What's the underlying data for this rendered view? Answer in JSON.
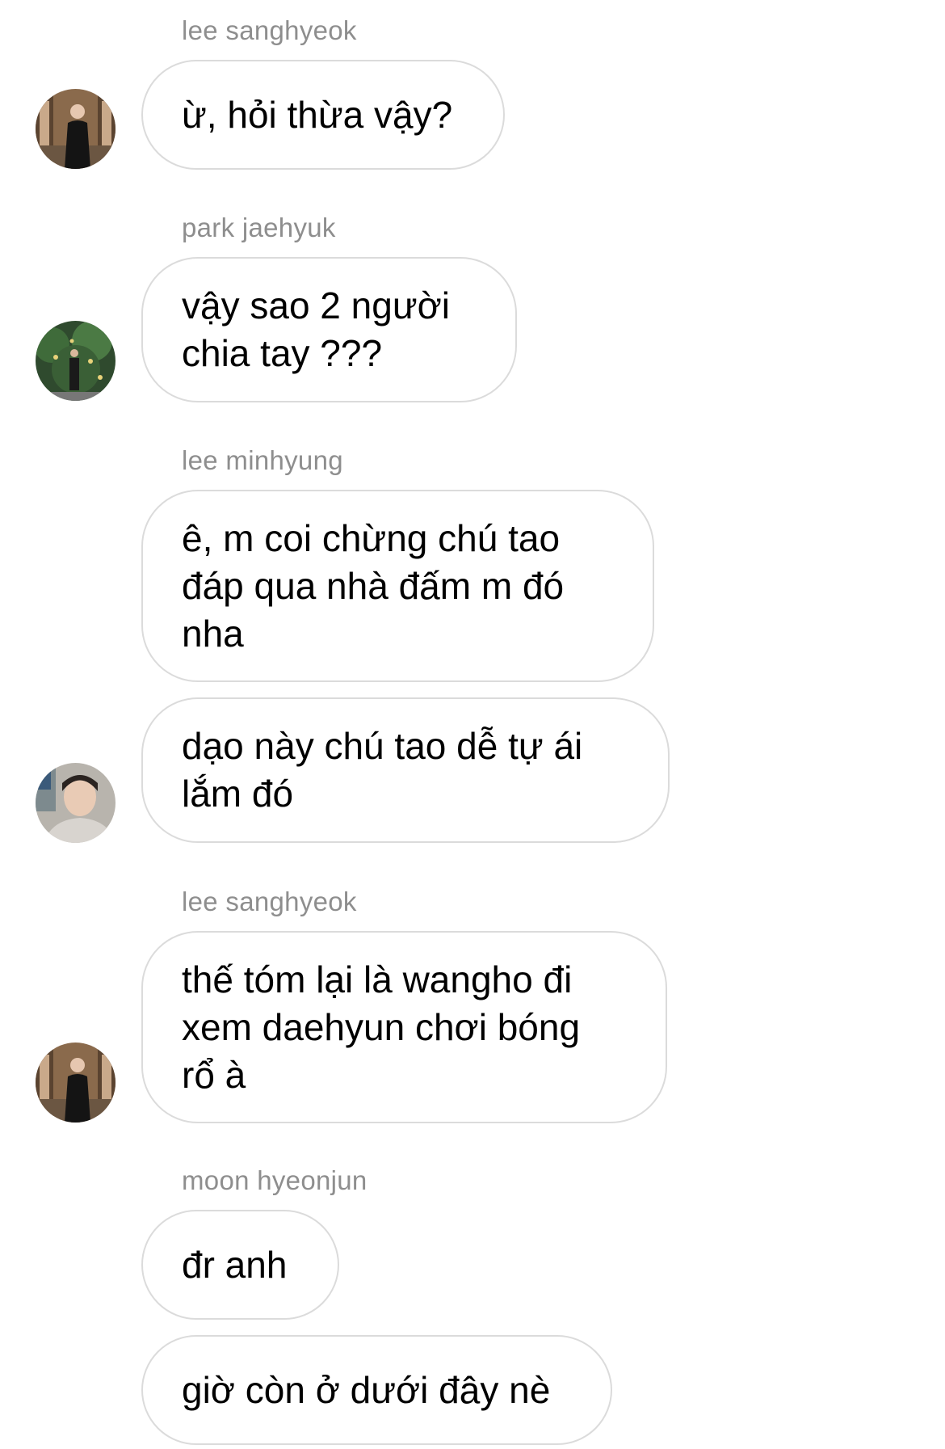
{
  "messages": [
    {
      "sender": "lee sanghyeok",
      "lines": [
        "ừ, hỏi thừa vậy?"
      ]
    },
    {
      "sender": "park jaehyuk",
      "lines": [
        "vậy sao 2 người",
        "chia tay ???"
      ]
    },
    {
      "sender": "lee minhyung",
      "lines": [
        "ê, m coi chừng chú tao",
        "đáp qua nhà đấm m đó",
        "nha"
      ]
    },
    {
      "lines": [
        "dạo này chú tao dễ tự ái",
        "lắm đó"
      ]
    },
    {
      "sender": "lee sanghyeok",
      "lines": [
        "thế tóm lại là wangho đi",
        "xem daehyun chơi bóng",
        "rổ à"
      ]
    },
    {
      "sender": "moon hyeonjun",
      "lines": [
        "đr anh"
      ]
    },
    {
      "lines": [
        "giờ còn ở dưới đây nè"
      ]
    }
  ],
  "avatars": {
    "lee_sanghyeok": "profile-photo",
    "park_jaehyuk": "profile-photo",
    "lee_minhyung": "profile-photo"
  },
  "colors": {
    "background": "#ffffff",
    "bubble_border": "#dbdbdb",
    "sender_name": "#8e8e8e",
    "message_text": "#000000"
  }
}
